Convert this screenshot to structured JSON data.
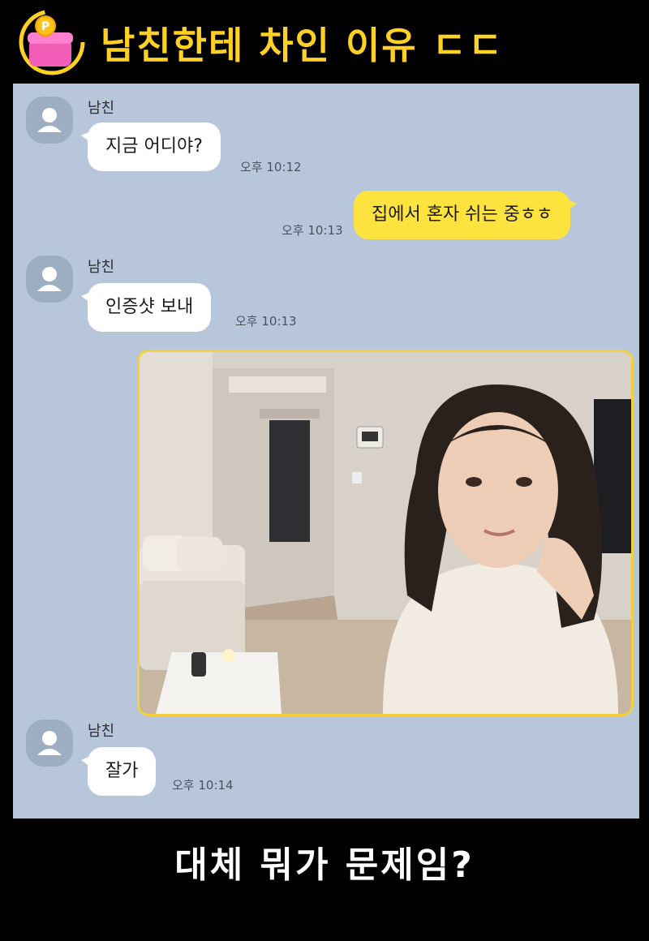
{
  "header": {
    "title": "남친한테 차인 이유 ㄷㄷ",
    "title_color": "#FFD026"
  },
  "messages": [
    {
      "sender": "남친",
      "text": "지금 어디야?",
      "time": "오후 10:12",
      "side": "left"
    },
    {
      "text": "집에서 혼자 쉬는 중ㅎㅎ",
      "time": "오후 10:13",
      "side": "right"
    },
    {
      "sender": "남친",
      "text": "인증샷 보내",
      "time": "오후 10:13",
      "side": "left"
    },
    {
      "type": "photo",
      "side": "right"
    },
    {
      "sender": "남친",
      "text": "잘가",
      "time": "오후 10:14",
      "side": "left"
    }
  ],
  "footer": {
    "caption": "대체 뭐가 문제임?"
  },
  "colors": {
    "chat_background": "#B7C6DA",
    "incoming_bubble": "#FFFFFF",
    "outgoing_bubble": "#FEE33E",
    "page_background": "#000000"
  }
}
